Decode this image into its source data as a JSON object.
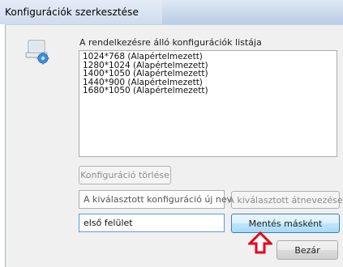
{
  "window": {
    "title": "Konfigurációk szerkesztése"
  },
  "list": {
    "label": "A rendelkezésre álló konfigurációk listája",
    "items": [
      "1024*768 (Alapértelmezett)",
      "1280*1024 (Alapértelmezett)",
      "1400*1050 (Alapértelmezett)",
      "1440*900 (Alapértelmezett)",
      "1680*1050 (Alapértelmezett)"
    ]
  },
  "buttons": {
    "delete": "Konfiguráció törlése",
    "rename": "A kiválasztott átnevezése",
    "save_as": "Mentés másként",
    "close": "Bezár"
  },
  "inputs": {
    "rename_placeholder": "A kiválasztott konfiguráció új neve",
    "new_name_value": "első felület"
  },
  "colors": {
    "arrow": "#e8001c",
    "accent": "#3c7fb1"
  },
  "icons": {
    "app": "config-computer-icon",
    "pointer": "up-arrow-icon"
  }
}
